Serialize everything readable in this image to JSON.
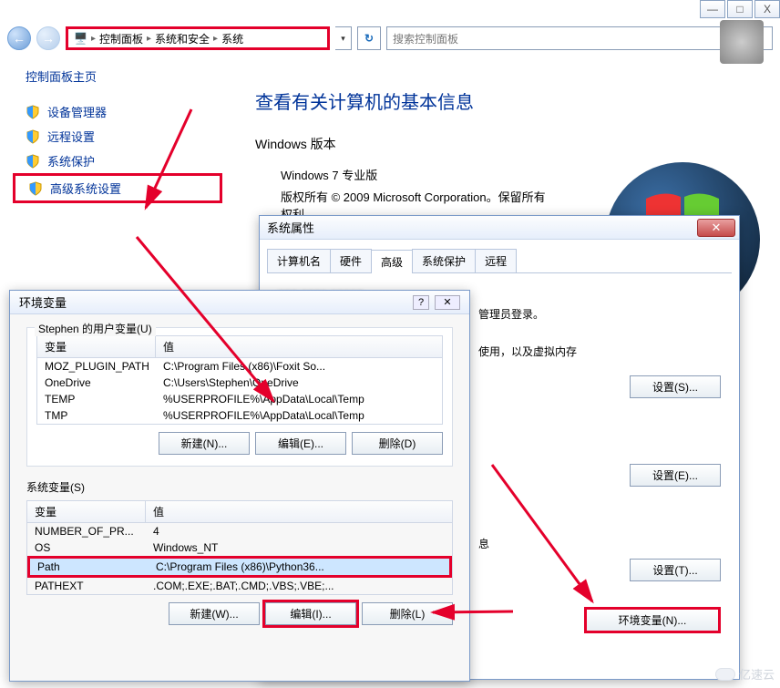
{
  "chrome": {
    "min": "—",
    "max": "□",
    "close": "X"
  },
  "nav": {
    "back": "←",
    "forward": "→",
    "segments": [
      "控制面板",
      "系统和安全",
      "系统"
    ],
    "search_placeholder": "搜索控制面板"
  },
  "sidebar": {
    "title": "控制面板主页",
    "items": [
      {
        "icon": "shield",
        "label": "设备管理器"
      },
      {
        "icon": "shield",
        "label": "远程设置"
      },
      {
        "icon": "shield",
        "label": "系统保护"
      },
      {
        "icon": "shield",
        "label": "高级系统设置"
      }
    ]
  },
  "main": {
    "heading": "查看有关计算机的基本信息",
    "section": "Windows 版本",
    "version": "Windows 7 专业版",
    "copyright": "版权所有 © 2009 Microsoft Corporation。保留所有权利。"
  },
  "sysprops": {
    "title": "系统属性",
    "tabs": [
      "计算机名",
      "硬件",
      "高级",
      "系统保护",
      "远程"
    ],
    "active_tab_index": 2,
    "admin_line": "管理员登录。",
    "perf_line": "使用，以及虚拟内存",
    "info_label": "息",
    "btn_settings_s": "设置(S)...",
    "btn_settings_e": "设置(E)...",
    "btn_settings_t": "设置(T)...",
    "btn_env": "环境变量(N)..."
  },
  "env": {
    "title": "环境变量",
    "user_group": "Stephen 的用户变量(U)",
    "sys_group": "系统变量(S)",
    "col_var": "变量",
    "col_val": "值",
    "user_vars": [
      {
        "k": "MOZ_PLUGIN_PATH",
        "v": "C:\\Program Files (x86)\\Foxit So..."
      },
      {
        "k": "OneDrive",
        "v": "C:\\Users\\Stephen\\OneDrive"
      },
      {
        "k": "TEMP",
        "v": "%USERPROFILE%\\AppData\\Local\\Temp"
      },
      {
        "k": "TMP",
        "v": "%USERPROFILE%\\AppData\\Local\\Temp"
      }
    ],
    "sys_vars": [
      {
        "k": "NUMBER_OF_PR...",
        "v": "4"
      },
      {
        "k": "OS",
        "v": "Windows_NT"
      },
      {
        "k": "Path",
        "v": "C:\\Program Files (x86)\\Python36..."
      },
      {
        "k": "PATHEXT",
        "v": ".COM;.EXE;.BAT;.CMD;.VBS;.VBE;..."
      }
    ],
    "btn_new_n": "新建(N)...",
    "btn_edit_e": "编辑(E)...",
    "btn_del_d": "删除(D)",
    "btn_new_w": "新建(W)...",
    "btn_edit_i": "编辑(I)...",
    "btn_del_l": "删除(L)"
  },
  "watermark": "亿速云",
  "colors": {
    "accent": "#e4002b",
    "link": "#003399"
  }
}
